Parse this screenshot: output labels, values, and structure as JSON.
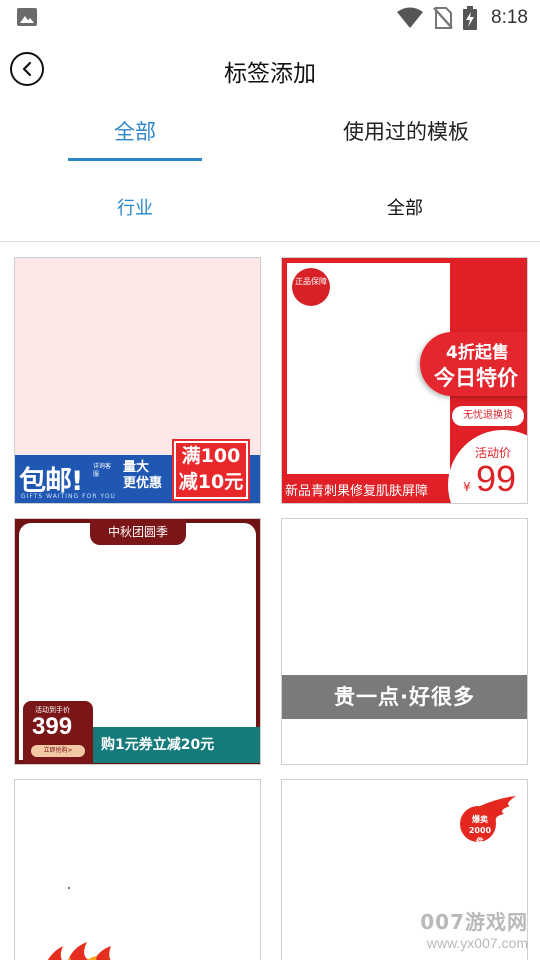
{
  "status_bar": {
    "time": "8:18",
    "icons": [
      "image-icon",
      "wifi-icon",
      "no-sim-icon",
      "battery-charging-icon"
    ]
  },
  "header": {
    "title": "标签添加",
    "back_icon": "back-arrow-icon"
  },
  "tabs": [
    {
      "label": "全部",
      "selected": true
    },
    {
      "label": "使用过的模板",
      "selected": false
    }
  ],
  "filters": [
    {
      "label": "行业",
      "selected": true
    },
    {
      "label": "全部",
      "selected": false
    }
  ],
  "accent_color": "#2b87c8",
  "templates": [
    {
      "bao": "包邮!",
      "small": "详询客服",
      "liang_1": "量大",
      "liang_2": "更优惠",
      "sub": "GIFTS WAITING FOR YOU",
      "red_1": "满100",
      "red_2": "减10元"
    },
    {
      "seal": "正品保障",
      "pill_1": "4折起售",
      "pill_2": "今日特价",
      "tag": "无忧退换货",
      "price_label": "活动价",
      "yen": "¥",
      "price": "99",
      "name": "新品青刺果修复肌肤屏障"
    },
    {
      "cap": "中秋团圆季",
      "price_label": "活动到手价",
      "price": "399",
      "button": "立即抢购>",
      "strip": "购1元券立减20元"
    },
    {
      "band": "贵一点·好很多"
    },
    {},
    {
      "badge": "爆卖2000件"
    }
  ],
  "watermark": {
    "title": "007游戏网",
    "url": "www.yx007.com"
  }
}
